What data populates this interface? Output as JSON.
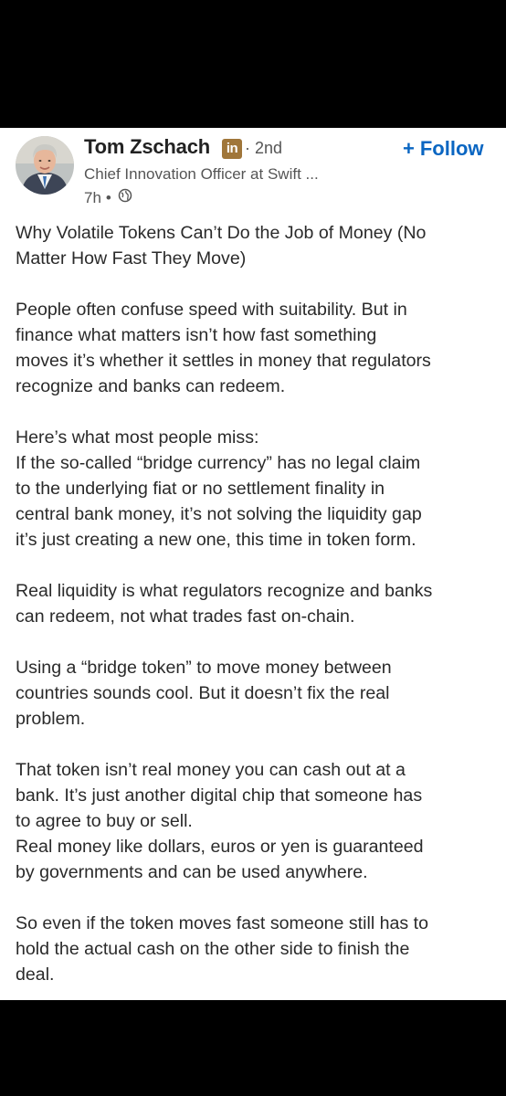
{
  "author": {
    "name": "Tom Zschach",
    "badge": "in",
    "degree": "· 2nd",
    "headline": "Chief Innovation Officer at Swift ...",
    "time": "7h",
    "time_separator": "•"
  },
  "follow": {
    "plus": "+",
    "label": "Follow"
  },
  "post": {
    "paragraphs": [
      "Why Volatile Tokens Can’t Do the Job of Money (No\nMatter How Fast They Move)",
      "People often confuse speed with suitability. But in\nfinance what matters isn’t how fast something\nmoves it’s whether it settles in money that regulators\nrecognize and banks can redeem.",
      "Here’s what most people miss:\nIf the so-called “bridge currency” has no legal claim\nto the underlying fiat or no settlement finality in\ncentral bank money, it’s not solving the liquidity gap\nit’s just creating a new one, this time in token form.",
      "Real liquidity is what regulators recognize and banks\ncan redeem, not what trades fast on-chain.",
      "Using a “bridge token” to move money between\ncountries sounds cool. But it doesn’t fix the real\nproblem.",
      "That token isn’t real money you can cash out at a\nbank. It’s just another digital chip that someone has\nto agree to buy or sell.\nReal money like dollars, euros or yen is guaranteed\nby governments and can be used anywhere.",
      "So even if the token moves fast someone still has to\nhold the actual cash on the other side to finish the\ndeal."
    ]
  },
  "icons": {
    "visibility": "globe-icon",
    "linkedin": "linkedin-badge-icon"
  },
  "colors": {
    "follow": "#0a66c2",
    "badge": "#a0763a",
    "background": "#ffffff",
    "frame": "#000000"
  }
}
